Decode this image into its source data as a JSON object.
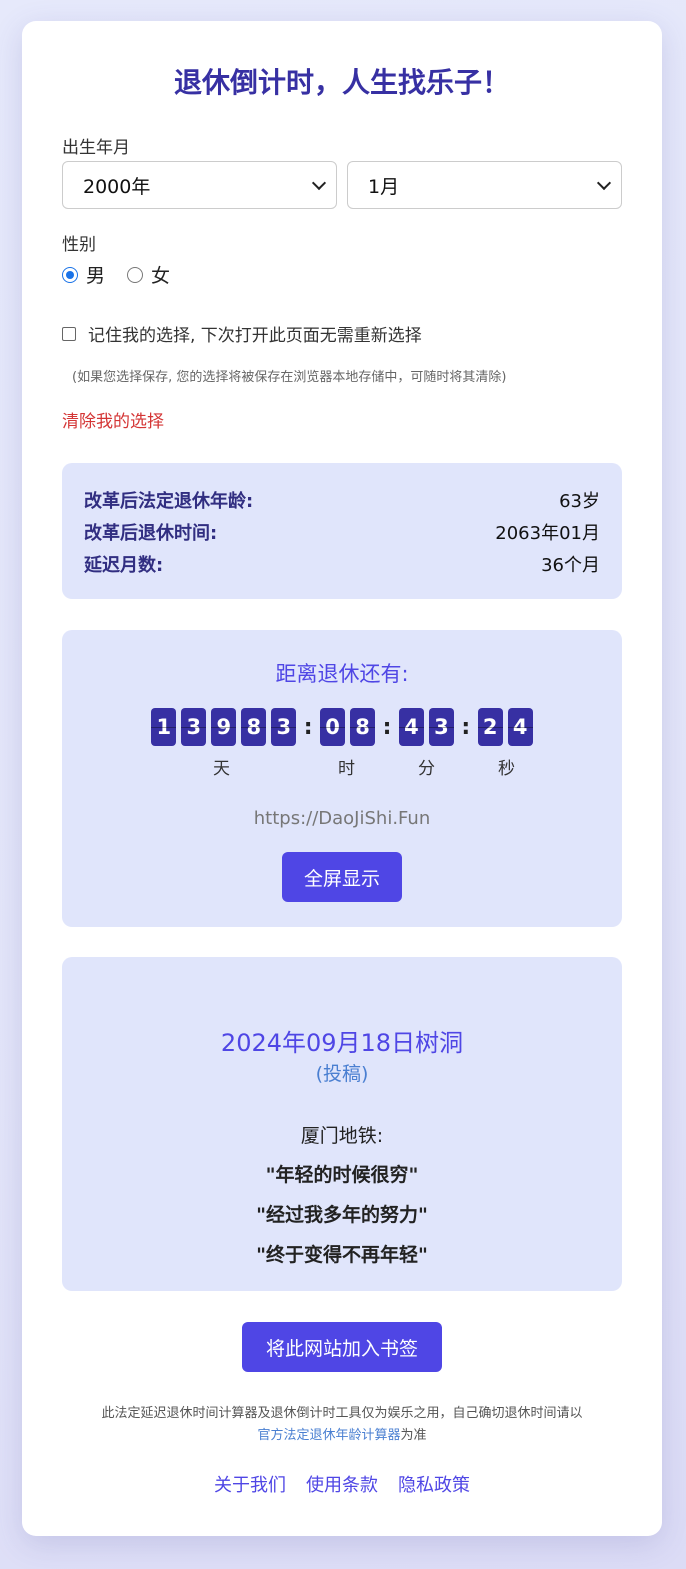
{
  "title": "退休倒计时，人生找乐子！",
  "form": {
    "birth_label": "出生年月",
    "year_value": "2000年",
    "month_value": "1月",
    "gender_label": "性别",
    "gender_options": [
      "男",
      "女"
    ],
    "gender_selected": "男",
    "remember_label": "记住我的选择, 下次打开此页面无需重新选择",
    "remember_checked": false,
    "remember_note": "(如果您选择保存, 您的选择将被保存在浏览器本地存储中，可随时将其清除)",
    "clear_link": "清除我的选择"
  },
  "result": {
    "rows": [
      {
        "key": "改革后法定退休年龄:",
        "value": "63岁"
      },
      {
        "key": "改革后退休时间:",
        "value": "2063年01月"
      },
      {
        "key": "延迟月数:",
        "value": "36个月"
      }
    ]
  },
  "countdown": {
    "title": "距离退休还有:",
    "days": [
      "1",
      "3",
      "9",
      "8",
      "3"
    ],
    "hours": [
      "0",
      "8"
    ],
    "minutes": [
      "4",
      "3"
    ],
    "seconds": [
      "2",
      "4"
    ],
    "units": {
      "days": "天",
      "hours": "时",
      "minutes": "分",
      "seconds": "秒"
    },
    "site_url": "https://DaoJiShi.Fun",
    "fullscreen_button": "全屏显示"
  },
  "treehole": {
    "title": "2024年09月18日树洞",
    "submit_link": "(投稿)",
    "lines": [
      "厦门地铁:",
      "\"年轻的时候很穷\"",
      "\"经过我多年的努力\"",
      "\"终于变得不再年轻\""
    ]
  },
  "bookmark_button": "将此网站加入书签",
  "disclaimer": {
    "text_before": "此法定延迟退休时间计算器及退休倒计时工具仅为娱乐之用，自己确切退休时间请以",
    "link": "官方法定退休年龄计算器",
    "text_after": "为准"
  },
  "footer": {
    "links": [
      "关于我们",
      "使用条款",
      "隐私政策"
    ]
  },
  "colors": {
    "accent": "#4f46e5",
    "title": "#3730a3",
    "panel_bg": "#e0e5fb",
    "danger": "#d43535"
  }
}
